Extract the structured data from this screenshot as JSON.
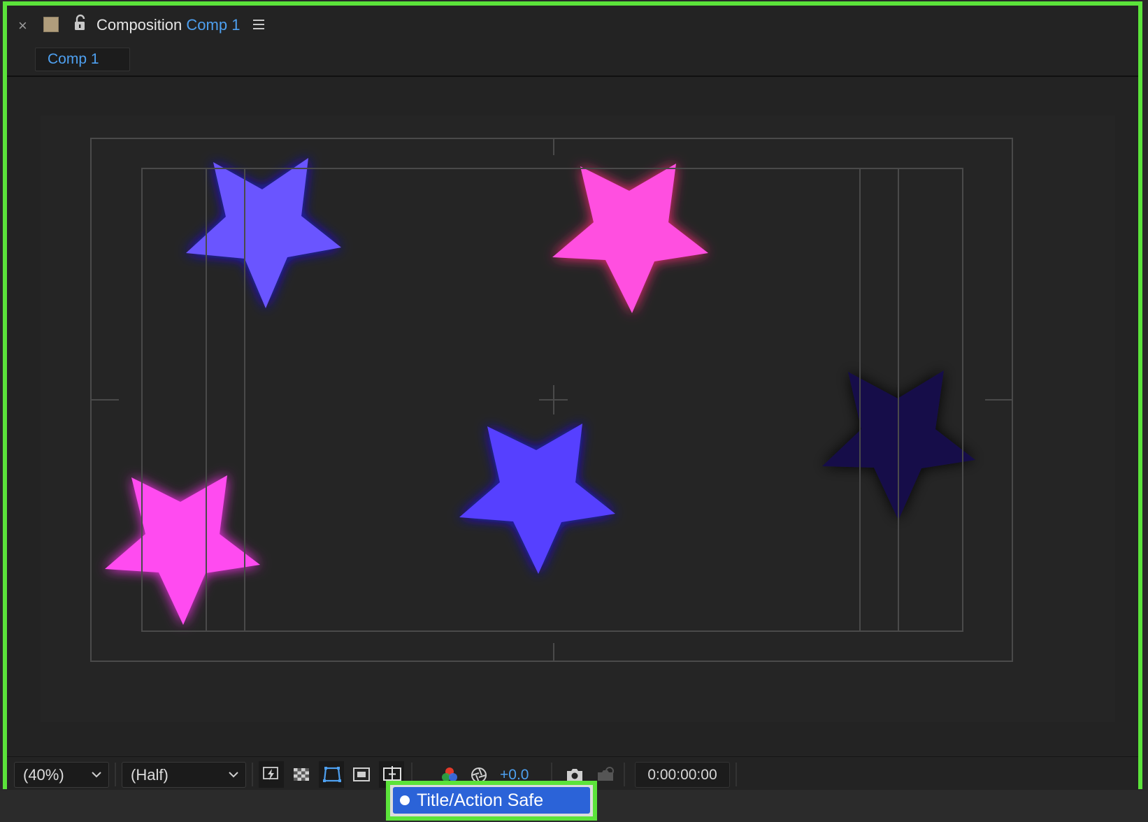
{
  "panel": {
    "close_symbol": "×",
    "title_prefix": "Composition",
    "comp_name": "Comp 1",
    "icons": [
      "close-icon",
      "color-label-swatch-icon",
      "lock-icon",
      "panel-menu-icon"
    ]
  },
  "tabs": [
    {
      "label": "Comp 1",
      "active": true
    }
  ],
  "viewer": {
    "stars": [
      {
        "name": "blue-star-top-left",
        "color": "#6b55ff"
      },
      {
        "name": "pink-star-top-right",
        "color": "#ff4fe0"
      },
      {
        "name": "blue-star-center",
        "color": "#5640ff"
      },
      {
        "name": "dark-star-right",
        "color": "#17104a"
      },
      {
        "name": "pink-star-bottom-left",
        "color": "#ff4cf0"
      }
    ],
    "guides": "title-action-safe"
  },
  "toolbar": {
    "magnification": "(40%)",
    "resolution": "(Half)",
    "exposure": "+0.0",
    "timecode": "0:00:00:00",
    "icons": [
      "fast-previews-icon",
      "transparency-grid-icon",
      "mask-visibility-icon",
      "region-of-interest-icon",
      "grid-guides-icon",
      "channel-icon",
      "exposure-reset-icon",
      "snapshot-icon",
      "show-snapshot-icon"
    ]
  },
  "tooltip": {
    "label": "Title/Action Safe"
  },
  "colors": {
    "accent": "#4ea0f0",
    "highlight": "#5be33a",
    "selected": "#2b63d8"
  }
}
